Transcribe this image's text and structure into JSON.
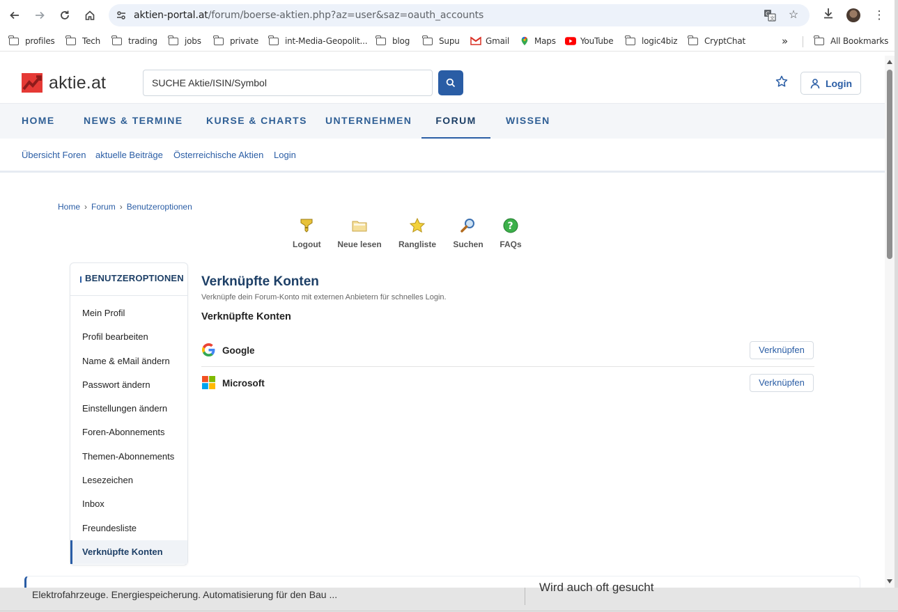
{
  "browser": {
    "url_host": "aktien-portal.at",
    "url_path": "/forum/boerse-aktien.php?az=user&saz=oauth_accounts",
    "bookmarks": [
      {
        "label": "profiles",
        "icon": "folder-icon"
      },
      {
        "label": "Tech",
        "icon": "folder-icon"
      },
      {
        "label": "trading",
        "icon": "folder-icon"
      },
      {
        "label": "jobs",
        "icon": "folder-icon"
      },
      {
        "label": "private",
        "icon": "folder-icon"
      },
      {
        "label": "int-Media-Geopolit...",
        "icon": "folder-icon"
      },
      {
        "label": "blog",
        "icon": "folder-icon"
      },
      {
        "label": "Supu",
        "icon": "folder-icon"
      },
      {
        "label": "Gmail",
        "icon": "gmail-icon"
      },
      {
        "label": "Maps",
        "icon": "maps-icon"
      },
      {
        "label": "YouTube",
        "icon": "youtube-icon"
      },
      {
        "label": "logic4biz",
        "icon": "folder-icon"
      },
      {
        "label": "CryptChat",
        "icon": "folder-icon"
      }
    ],
    "all_bookmarks": "All Bookmarks",
    "overflow": "»"
  },
  "header": {
    "logo_text": "aktie.at",
    "search_placeholder": "SUCHE Aktie/ISIN/Symbol",
    "login_label": "Login"
  },
  "mainnav": [
    "HOME",
    "NEWS & TERMINE",
    "KURSE & CHARTS",
    "UNTERNEHMEN",
    "FORUM",
    "WISSEN"
  ],
  "subnav": [
    "Übersicht Foren",
    "aktuelle Beiträge",
    "Österreichische Aktien",
    "Login"
  ],
  "breadcrumb": [
    "Home",
    "Forum",
    "Benutzeroptionen"
  ],
  "breadcrumb_sep": "›",
  "tools": [
    {
      "label": "Logout",
      "icon": "key-icon"
    },
    {
      "label": "Neue lesen",
      "icon": "folder-icon"
    },
    {
      "label": "Rangliste",
      "icon": "star-icon"
    },
    {
      "label": "Suchen",
      "icon": "magnifier-icon"
    },
    {
      "label": "FAQs",
      "icon": "help-icon"
    }
  ],
  "sidemenu": {
    "title": "BENUTZEROPTIONEN",
    "items": [
      "Mein Profil",
      "Profil bearbeiten",
      "Name & eMail ändern",
      "Passwort ändern",
      "Einstellungen ändern",
      "Foren-Abonnements",
      "Themen-Abonnements",
      "Lesezeichen",
      "Inbox",
      "Freundesliste",
      "Verknüpfte Konten"
    ],
    "active": "Verknüpfte Konten"
  },
  "content": {
    "title": "Verknüpfte Konten",
    "subtitle": "Verknüpfe dein Forum-Konto mit externen Anbietern für schnelles Login.",
    "section_title": "Verknüpfte Konten",
    "providers": [
      {
        "name": "Google",
        "button": "Verknüpfen",
        "icon": "google-icon"
      },
      {
        "name": "Microsoft",
        "button": "Verknüpfen",
        "icon": "microsoft-icon"
      }
    ]
  },
  "background_window": {
    "left_text": "Elektrofahrzeuge. Energiespeicherung. Automatisierung für den Bau ...",
    "right_text": "Wird auch oft gesucht"
  },
  "colors": {
    "brand": "#2a5da5",
    "logo_red": "#e53935",
    "dark_blue": "#1d3f66"
  }
}
